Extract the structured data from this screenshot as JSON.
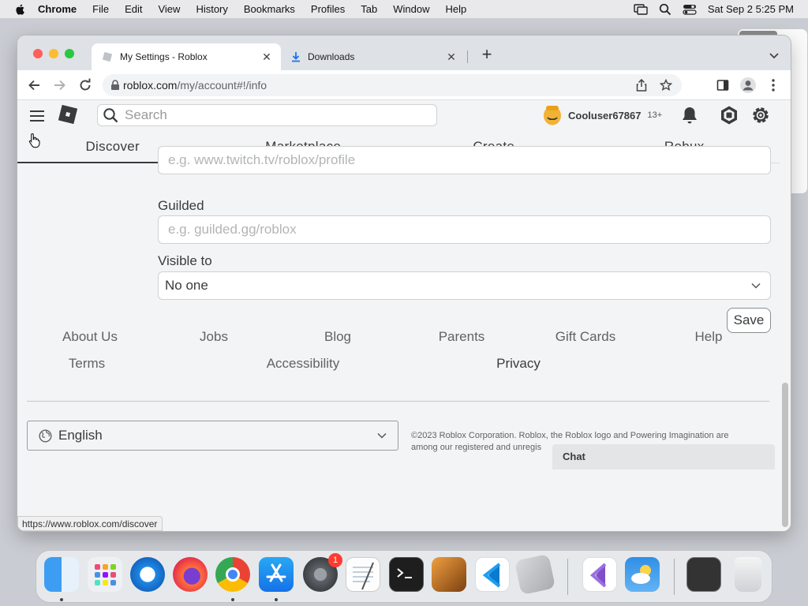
{
  "menubar": {
    "app": "Chrome",
    "items": [
      "File",
      "Edit",
      "View",
      "History",
      "Bookmarks",
      "Profiles",
      "Tab",
      "Window",
      "Help"
    ],
    "datetime": "Sat Sep 2  5:25 PM"
  },
  "browser": {
    "tabs": [
      {
        "title": "My Settings - Roblox",
        "active": true,
        "icon": "roblox-favicon-icon"
      },
      {
        "title": "Downloads",
        "active": false,
        "icon": "download-icon"
      }
    ],
    "address": {
      "domain": "roblox.com",
      "path": "/my/account#!/info"
    },
    "status_url": "https://www.roblox.com/discover"
  },
  "header": {
    "search_placeholder": "Search",
    "username": "Cooluser67867",
    "age_badge": "13+",
    "nav": [
      "Discover",
      "Marketplace",
      "Create",
      "Robux"
    ]
  },
  "form": {
    "twitch_placeholder": "e.g. www.twitch.tv/roblox/profile",
    "guilded_label": "Guilded",
    "guilded_placeholder": "e.g. guilded.gg/roblox",
    "visible_label": "Visible to",
    "visible_value": "No one",
    "save_label": "Save"
  },
  "footer": {
    "links_row1": [
      "About Us",
      "Jobs",
      "Blog",
      "Parents",
      "Gift Cards",
      "Help"
    ],
    "links_row2": [
      "Terms",
      "Accessibility",
      "Privacy"
    ],
    "language": "English",
    "copyright_line1": "©2023 Roblox Corporation. Roblox, the Roblox logo and Powering Imagination are",
    "copyright_line2": "among our registered and unregis",
    "chat_label": "Chat"
  },
  "dock": {
    "apps": [
      "Finder",
      "Launchpad",
      "Safari",
      "Firefox",
      "Chrome",
      "App Store",
      "System Settings",
      "TextEdit",
      "Terminal",
      "GarageBand",
      "Visual Studio Code",
      "Roblox",
      "Visual Studio",
      "Weather",
      "Screenshot",
      "Trash"
    ],
    "settings_badge": "1"
  },
  "colors": {
    "roblox_text": "#393b3d",
    "page_bg": "#f2f4f5",
    "badge": "#ff3b30"
  }
}
